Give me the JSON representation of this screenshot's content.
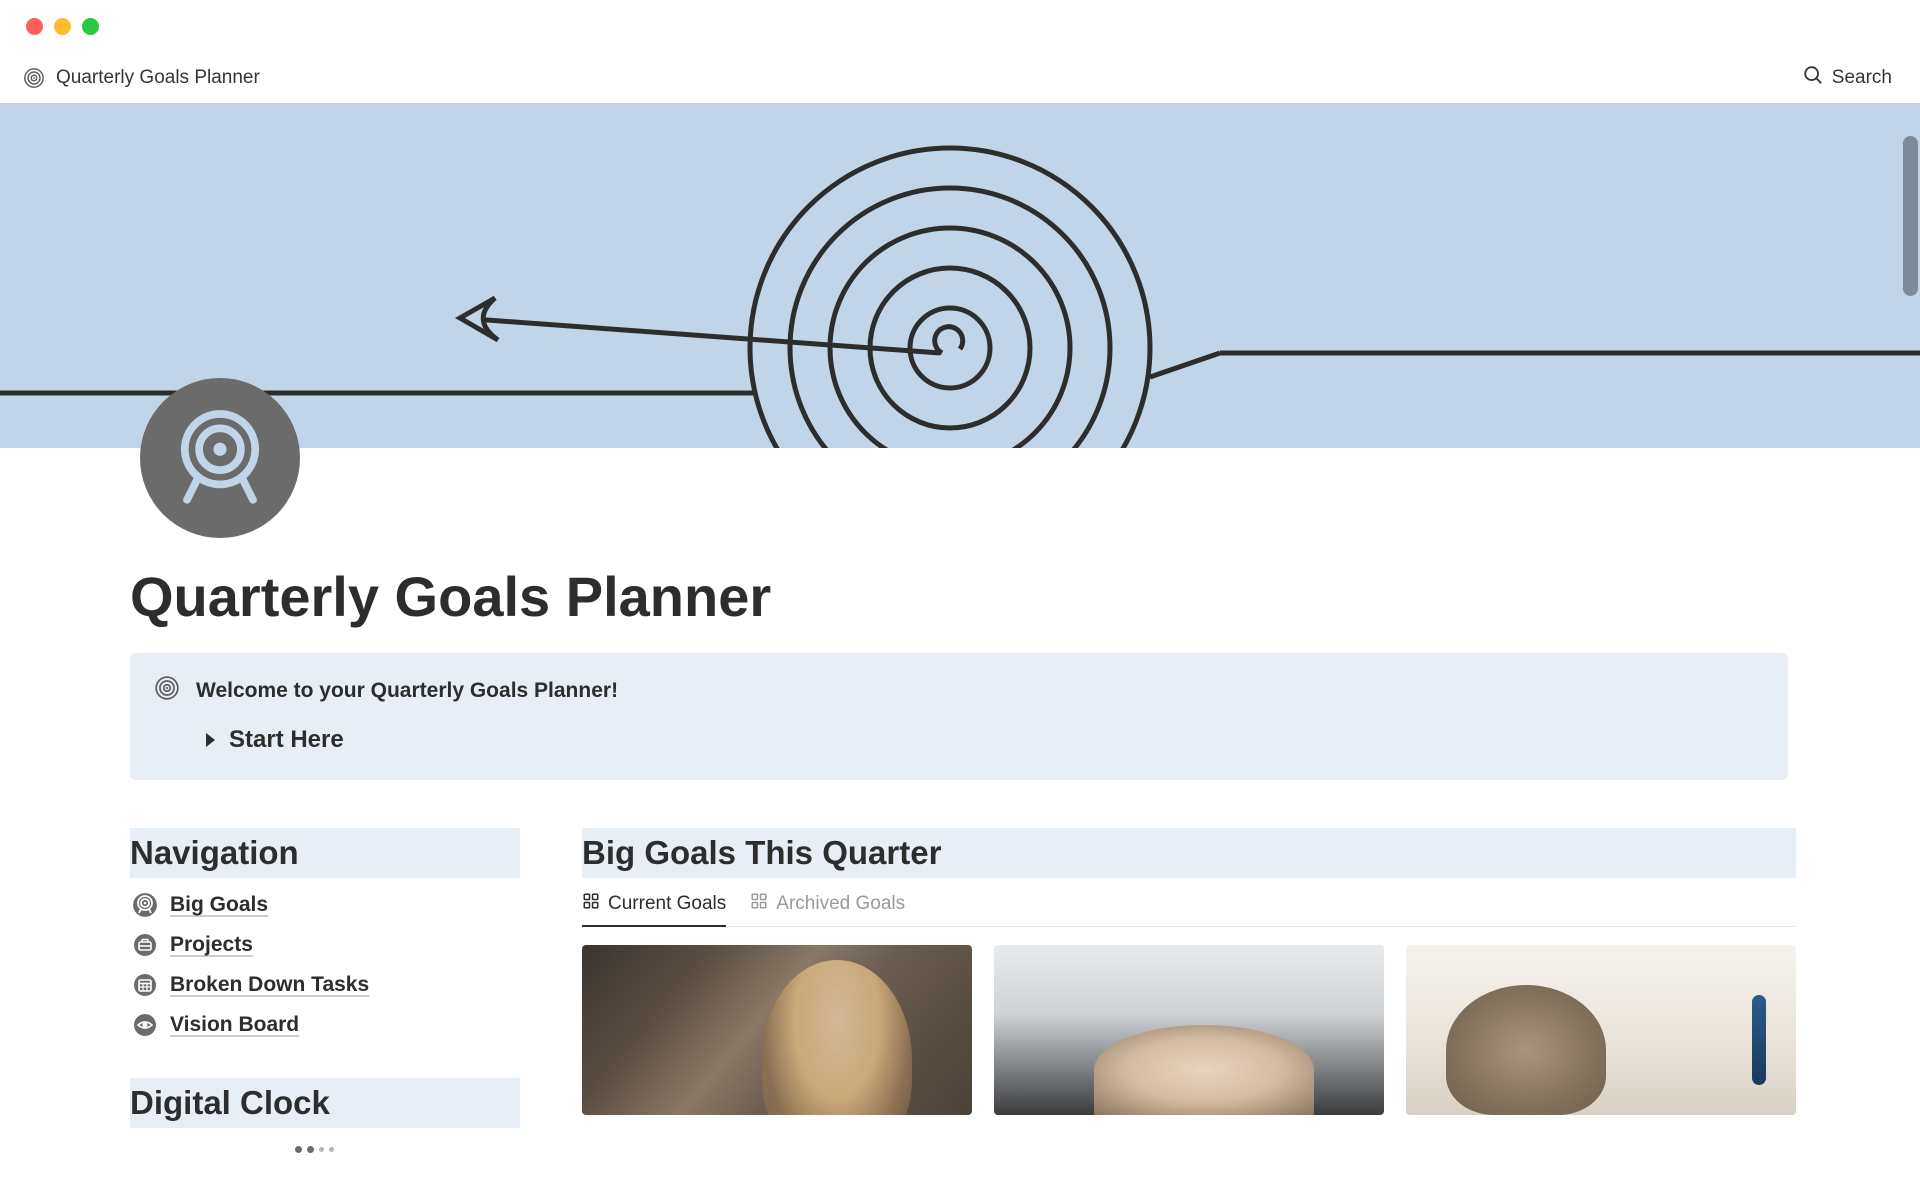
{
  "breadcrumb": {
    "title": "Quarterly Goals Planner"
  },
  "search": {
    "label": "Search"
  },
  "page": {
    "title": "Quarterly Goals Planner"
  },
  "callout": {
    "welcome_text": "Welcome to your Quarterly Goals Planner!",
    "start_label": "Start Here"
  },
  "sections": {
    "navigation_heading": "Navigation",
    "big_goals_heading": "Big Goals This Quarter",
    "digital_clock_heading": "Digital Clock"
  },
  "navigation": {
    "items": [
      {
        "label": "Big Goals",
        "icon": "target"
      },
      {
        "label": "Projects",
        "icon": "briefcase"
      },
      {
        "label": "Broken Down Tasks",
        "icon": "calendar"
      },
      {
        "label": "Vision Board",
        "icon": "eye"
      }
    ]
  },
  "tabs": {
    "current": "Current Goals",
    "archived": "Archived Goals"
  }
}
